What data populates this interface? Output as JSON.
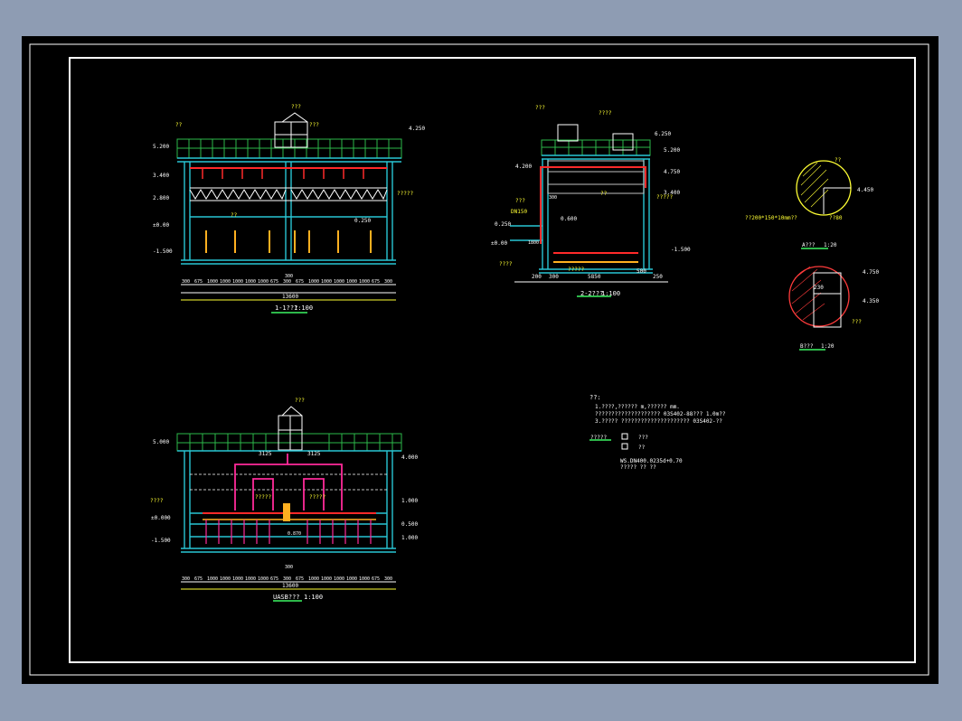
{
  "section_1_1": {
    "title": "1-1???",
    "scale": "1:100",
    "labels": {
      "tank": "??",
      "unit": "???",
      "sub": "???",
      "mid": "??",
      "pump": "?????"
    },
    "elevations": [
      "4.250",
      "3.400",
      "2.800",
      "±0.00",
      "-1.500",
      "5.200",
      "0.250"
    ],
    "dims": [
      "300",
      "675",
      "1000",
      "1000",
      "1000",
      "1000",
      "1000",
      "675",
      "300",
      "675",
      "1000",
      "1000",
      "1000",
      "1000",
      "1000",
      "675",
      "300"
    ],
    "total": "13600",
    "mid_dim": "300"
  },
  "section_2_2": {
    "title": "2-2???",
    "scale": "1:100",
    "labels": {
      "tank": "???",
      "unit": "????",
      "sub": "???",
      "left": "???",
      "pipe": "DN150",
      "pump": "????",
      "bottom": "?????",
      "right": "?????",
      "mid": "??"
    },
    "elevations": [
      "6.250",
      "5.200",
      "4.750",
      "3.400",
      "4.200",
      "0.250",
      "±0.00",
      "-1.500",
      "0.600"
    ],
    "dims": [
      "200",
      "300",
      "5850",
      "500",
      "250"
    ],
    "inner_dims": [
      "300",
      "1800"
    ]
  },
  "uasb": {
    "title": "UASB???",
    "scale": "1:100",
    "labels": {
      "top": "???",
      "left": "????",
      "a": "?????",
      "b": "?????"
    },
    "elevations": [
      "5.000",
      "4.000",
      "1.000",
      "±0.000",
      "0.500",
      "-1.500",
      "1.000"
    ],
    "top_dims": [
      "3125",
      "3125"
    ],
    "dims": [
      "300",
      "675",
      "1000",
      "1000",
      "1000",
      "1000",
      "1000",
      "675",
      "300",
      "675",
      "1000",
      "1000",
      "1000",
      "1000",
      "1000",
      "675",
      "300"
    ],
    "total": "13600",
    "mid_dim": "300",
    "small_dim": "0.870"
  },
  "detail_a": {
    "title": "A???",
    "scale": "1:20",
    "label": "??",
    "elev": "4.450",
    "caption": "??200*150*10mm??",
    "note": "??80"
  },
  "detail_b": {
    "title": "B???",
    "scale": "1:20",
    "elev_top": "4.750",
    "elev_mid": "4.350",
    "dim": "230",
    "label": "???"
  },
  "notes": {
    "header": "??:",
    "lines": [
      "1.????,?????? m,?????? mm.",
      "????????????????????    03S402-88??? 1.0m??",
      "3.????? ?????????????????????     03S402-??"
    ],
    "legend_title": "?????",
    "legend_items": [
      "???",
      "??"
    ],
    "spec": "WS.DN400.0235d+0.70",
    "spec2": "????? ?? ??"
  }
}
